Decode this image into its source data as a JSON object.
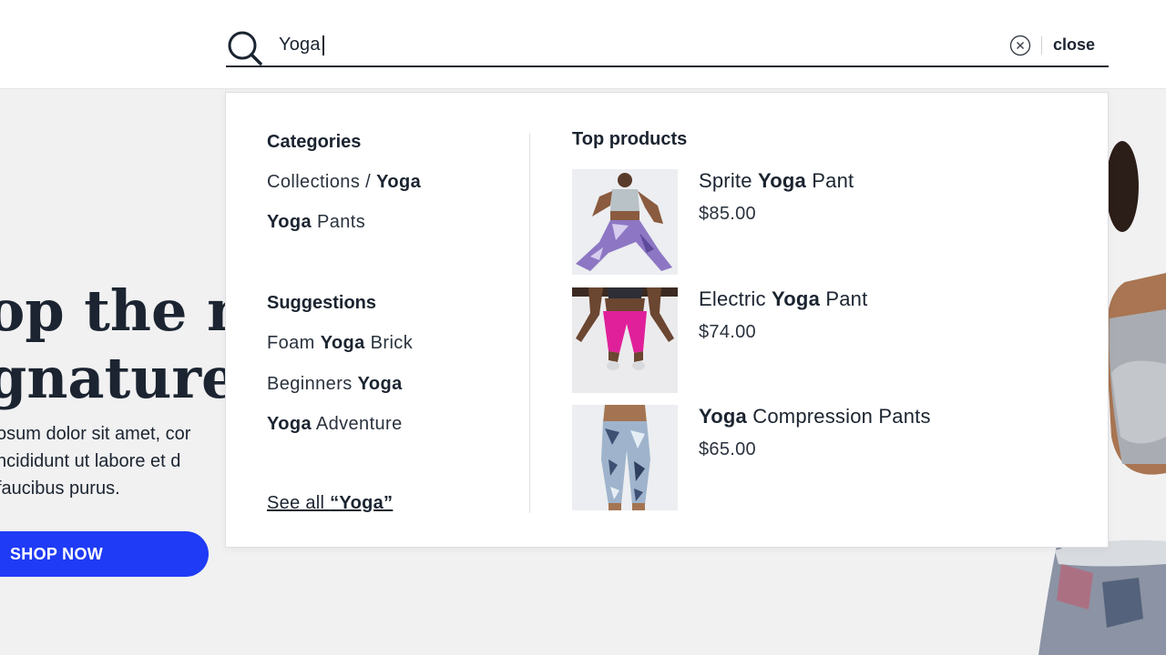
{
  "search": {
    "query": "Yoga",
    "close_label": "close"
  },
  "hero": {
    "headline_line1": "op the n",
    "headline_line2": "gnature C",
    "body_line1": "osum dolor sit amet, cor",
    "body_line2": "ncididunt ut labore et d",
    "body_line3": " faucibus purus.",
    "cta_label": "SHOP NOW"
  },
  "dropdown": {
    "categories_title": "Categories",
    "categories": [
      {
        "before": "Collections / ",
        "match": "Yoga",
        "after": ""
      },
      {
        "before": "",
        "match": "Yoga",
        "after": " Pants"
      }
    ],
    "suggestions_title": "Suggestions",
    "suggestions": [
      {
        "before": "Foam ",
        "match": "Yoga",
        "after": " Brick"
      },
      {
        "before": "Beginners ",
        "match": "Yoga",
        "after": ""
      },
      {
        "before": "",
        "match": "Yoga",
        "after": " Adventure"
      }
    ],
    "see_all_prefix": "See all ",
    "see_all_query": "“Yoga”",
    "products_title": "Top products",
    "products": [
      {
        "before": "Sprite ",
        "match": "Yoga",
        "after": " Pant",
        "price": "$85.00"
      },
      {
        "before": "Electric ",
        "match": "Yoga",
        "after": " Pant",
        "price": "$74.00"
      },
      {
        "before": "",
        "match": "Yoga",
        "after": " Compression Pants",
        "price": "$65.00"
      }
    ]
  },
  "colors": {
    "accent": "#1f3bf5",
    "text": "#1b2430",
    "background": "#f1f1f2"
  },
  "icons": {
    "search": "search-icon",
    "clear": "clear-circle-x-icon"
  }
}
